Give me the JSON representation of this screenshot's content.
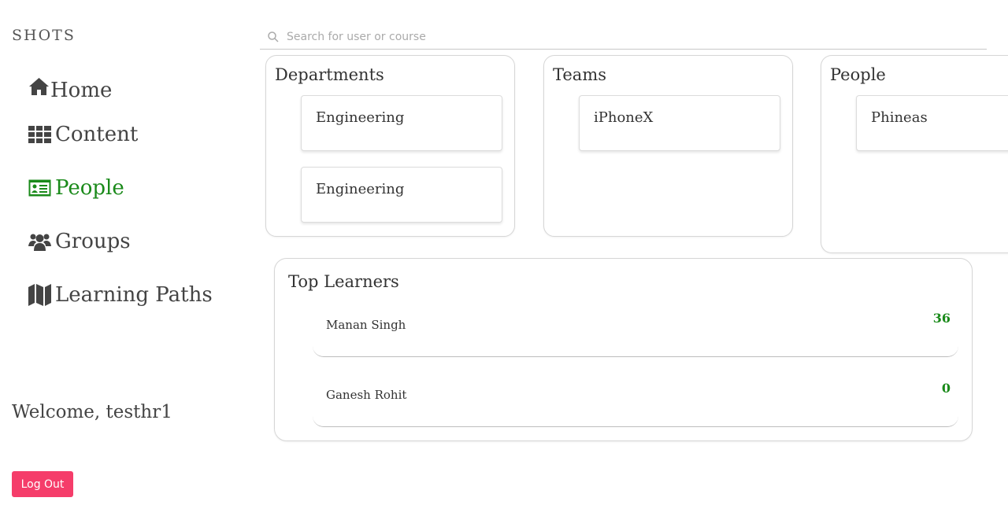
{
  "brand": "SHOTS",
  "nav": {
    "items": [
      {
        "label": "Home"
      },
      {
        "label": "Content"
      },
      {
        "label": "People"
      },
      {
        "label": "Groups"
      },
      {
        "label": "Learning Paths"
      }
    ],
    "active": "People",
    "active_color": "#1a8a1a"
  },
  "welcome": "Welcome, testhr1",
  "logout_label": "Log Out",
  "search": {
    "placeholder": "Search for user or course",
    "value": ""
  },
  "departments": {
    "title": "Departments",
    "items": [
      "Engineering",
      "Engineering"
    ]
  },
  "teams": {
    "title": "Teams",
    "items": [
      "iPhoneX"
    ]
  },
  "people": {
    "title": "People",
    "items": [
      "Phineas"
    ]
  },
  "top_learners": {
    "title": "Top Learners",
    "rows": [
      {
        "name": "Manan Singh",
        "score": "36"
      },
      {
        "name": "Ganesh Rohit",
        "score": "0"
      }
    ]
  },
  "colors": {
    "accent_green": "#1a8a1a",
    "logout_bg": "#f53d6a"
  }
}
